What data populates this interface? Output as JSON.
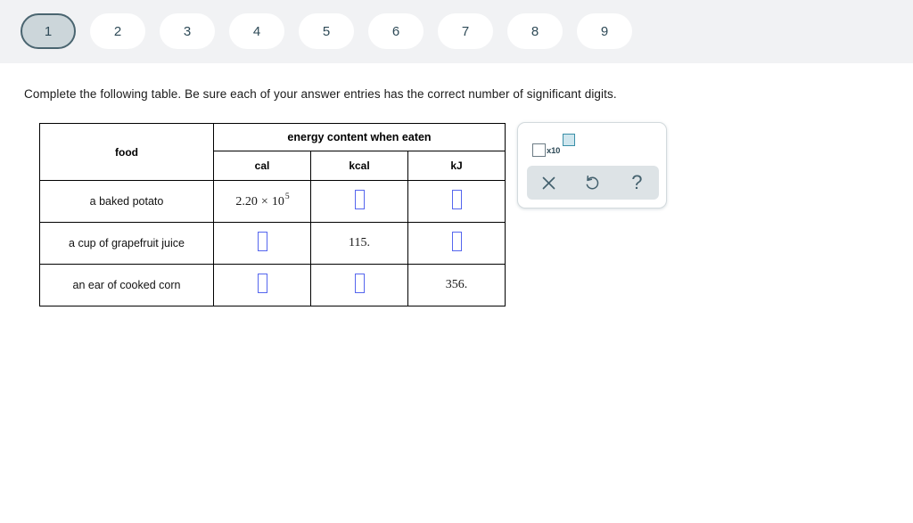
{
  "tabs": {
    "items": [
      {
        "label": "1",
        "active": true
      },
      {
        "label": "2",
        "active": false
      },
      {
        "label": "3",
        "active": false
      },
      {
        "label": "4",
        "active": false
      },
      {
        "label": "5",
        "active": false
      },
      {
        "label": "6",
        "active": false
      },
      {
        "label": "7",
        "active": false
      },
      {
        "label": "8",
        "active": false
      },
      {
        "label": "9",
        "active": false
      }
    ]
  },
  "prompt": {
    "text": "Complete the following table. Be sure each of your answer entries has the correct number of significant digits."
  },
  "table": {
    "headers": {
      "food": "food",
      "group": "energy content when eaten",
      "cal": "cal",
      "kcal": "kcal",
      "kJ": "kJ"
    },
    "rows": [
      {
        "food": "a baked potato",
        "cal": {
          "type": "scientific",
          "mantissa": "2.20",
          "times": "×",
          "base": "10",
          "exponent": "5"
        },
        "kcal": {
          "type": "input",
          "value": ""
        },
        "kJ": {
          "type": "input",
          "value": ""
        }
      },
      {
        "food": "a cup of grapefruit juice",
        "cal": {
          "type": "input",
          "value": ""
        },
        "kcal": {
          "type": "text",
          "value": "115."
        },
        "kJ": {
          "type": "input",
          "value": ""
        }
      },
      {
        "food": "an ear of cooked corn",
        "cal": {
          "type": "input",
          "value": ""
        },
        "kcal": {
          "type": "input",
          "value": ""
        },
        "kJ": {
          "type": "text",
          "value": "356."
        }
      }
    ]
  },
  "palette": {
    "scientific_notation_tool": {
      "multiplier_label": "x10",
      "icon": "scientific-notation-icon"
    },
    "actions": [
      {
        "name": "clear-button",
        "icon": "close-icon",
        "label": "×"
      },
      {
        "name": "undo-button",
        "icon": "undo-icon",
        "label": "↺"
      },
      {
        "name": "help-button",
        "icon": "question-mark-icon",
        "label": "?"
      }
    ]
  },
  "colors": {
    "topbar_bg": "#f1f2f4",
    "active_tab_bg": "#ccd6da",
    "active_tab_border": "#4a6570",
    "tab_text": "#2e4a57",
    "input_border": "#5566ee",
    "palette_action_bg": "#dde3e6",
    "icon_color": "#44616e",
    "exponent_fill": "#cfe6ee",
    "exponent_border": "#3a8fa8"
  }
}
